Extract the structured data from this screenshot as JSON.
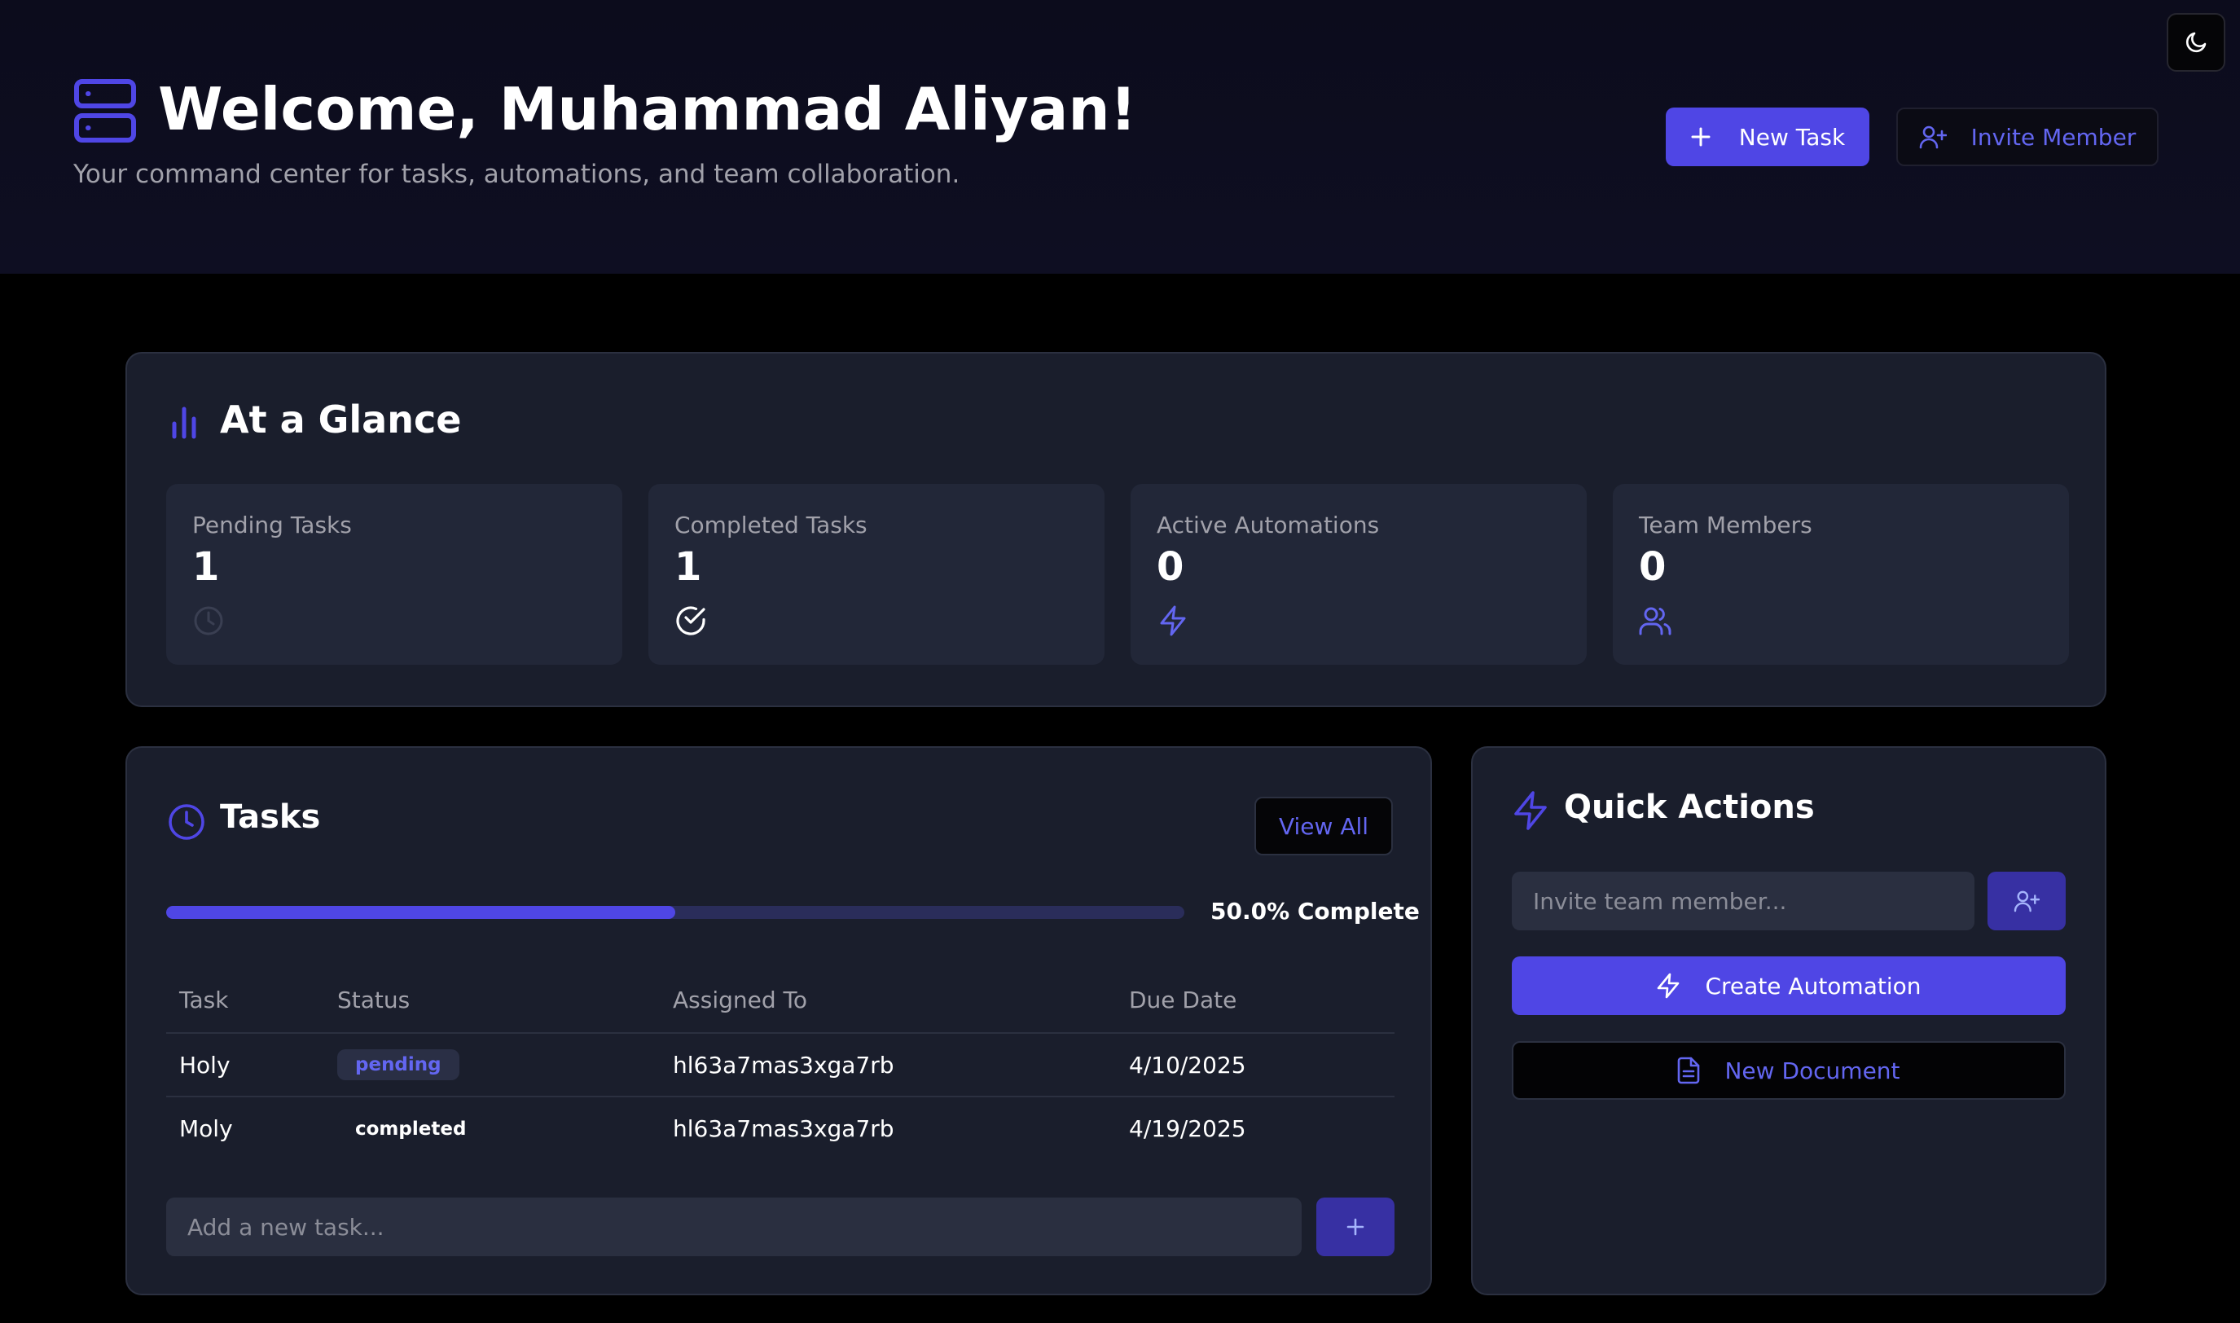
{
  "header": {
    "title": "Welcome, Muhammad Aliyan!",
    "subtitle": "Your command center for tasks, automations, and team collaboration.",
    "new_task_label": "New Task",
    "invite_member_label": "Invite Member",
    "logo_icon": "server-icon",
    "theme_toggle_icon": "moon-icon"
  },
  "glance": {
    "title": "At a Glance",
    "icon": "bar-chart-icon",
    "stats": [
      {
        "label": "Pending Tasks",
        "value": "1",
        "icon": "clock-icon"
      },
      {
        "label": "Completed Tasks",
        "value": "1",
        "icon": "check-circle-icon"
      },
      {
        "label": "Active Automations",
        "value": "0",
        "icon": "zap-icon"
      },
      {
        "label": "Team Members",
        "value": "0",
        "icon": "users-icon"
      }
    ]
  },
  "tasks": {
    "title": "Tasks",
    "view_all_label": "View All",
    "progress_percent": 50.0,
    "progress_label": "50.0% Complete",
    "columns": [
      "Task",
      "Status",
      "Assigned To",
      "Due Date"
    ],
    "rows": [
      {
        "task": "Holy",
        "status": "pending",
        "assigned_to": "hl63a7mas3xga7rb",
        "due_date": "4/10/2025"
      },
      {
        "task": "Moly",
        "status": "completed",
        "assigned_to": "hl63a7mas3xga7rb",
        "due_date": "4/19/2025"
      }
    ],
    "new_task_placeholder": "Add a new task..."
  },
  "quick_actions": {
    "title": "Quick Actions",
    "invite_placeholder": "Invite team member...",
    "create_automation_label": "Create Automation",
    "new_document_label": "New Document"
  },
  "colors": {
    "accent": "#4f46e5",
    "accent_text": "#6366f1",
    "background": "#000000",
    "card": "#1a1e2c"
  }
}
